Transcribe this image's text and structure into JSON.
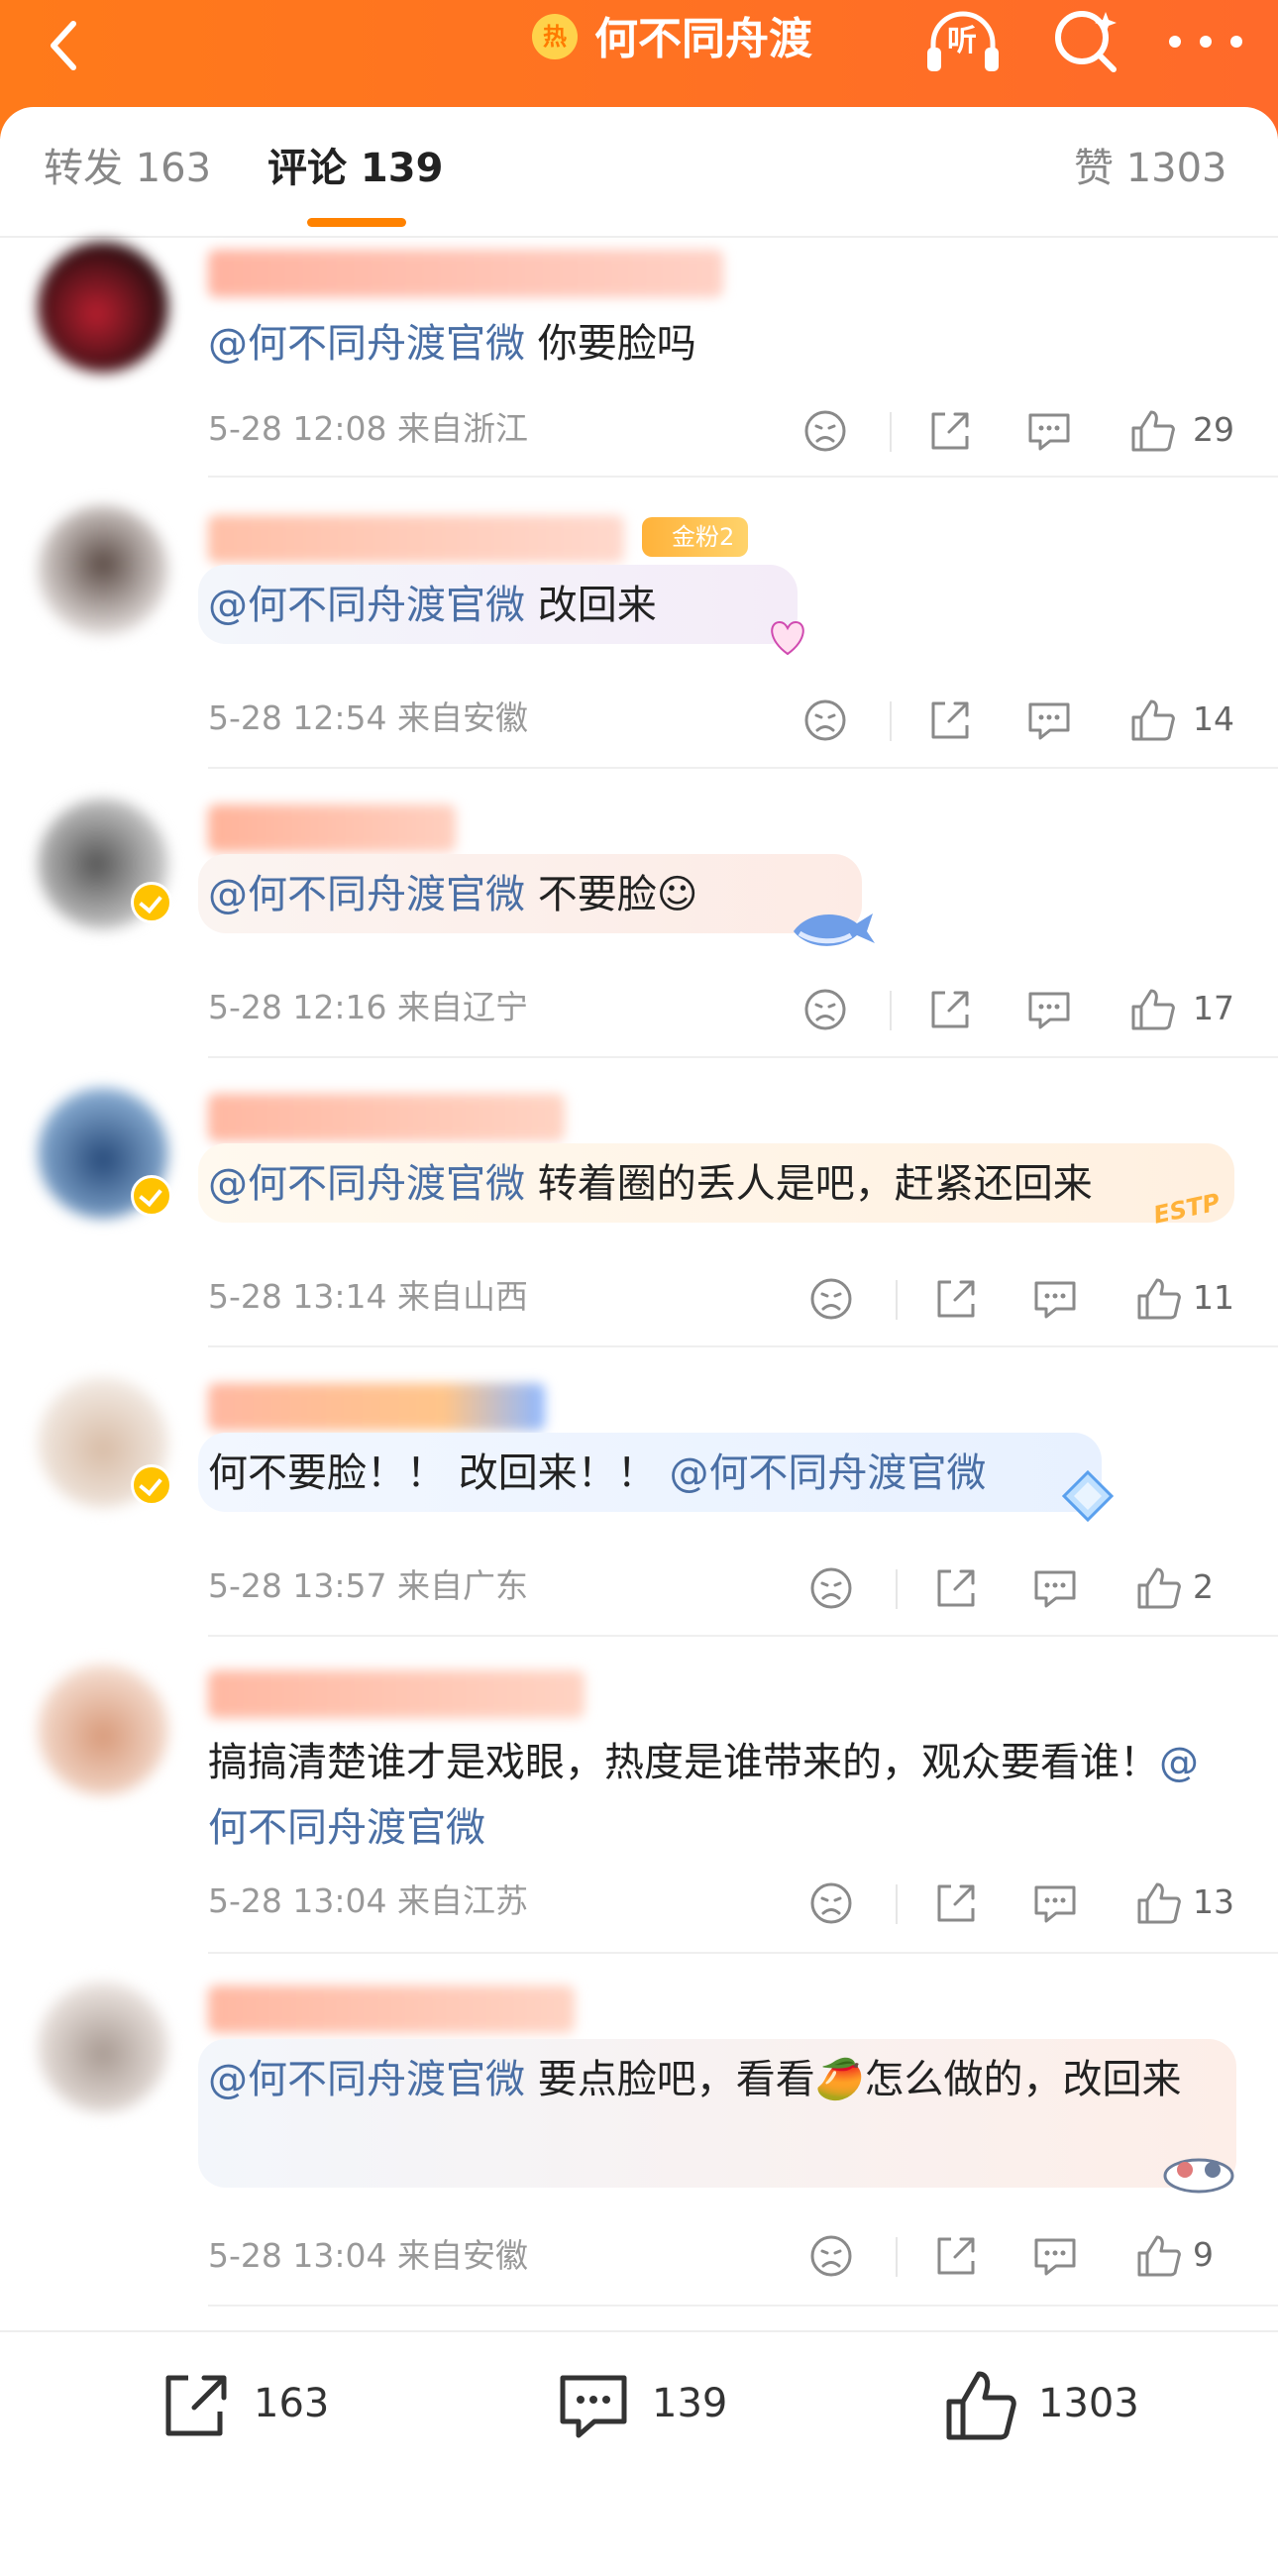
{
  "header": {
    "title": "何不同舟渡",
    "hot_label": "热",
    "listen_label": "听",
    "brand_color": "#ff7a1a"
  },
  "tabs": [
    {
      "label": "转发 163"
    },
    {
      "label": "评论 139"
    },
    {
      "label": "赞 1303"
    }
  ],
  "comments": [
    {
      "fan_badge": "",
      "at": "@何不同舟渡官微",
      "text": " 你要脸吗",
      "meta": "5-28 12:08  来自浙江",
      "likes": "29",
      "verified": false
    },
    {
      "fan_badge": "金粉2",
      "at": "@何不同舟渡官微",
      "text": " 改回来",
      "meta": "5-28 12:54  来自安徽",
      "likes": "14",
      "verified": false
    },
    {
      "fan_badge": "",
      "at": "@何不同舟渡官微",
      "text": " 不要脸☺",
      "meta": "5-28 12:16  来自辽宁",
      "likes": "17",
      "verified": true
    },
    {
      "fan_badge": "",
      "at": "@何不同舟渡官微",
      "text": " 转着圈的丢人是吧，赶紧还回来",
      "meta": "5-28 13:14  来自山西",
      "likes": "11",
      "verified": true,
      "sticker_label": "ESTP"
    },
    {
      "fan_badge": "",
      "pre_text": "何不要脸！！ 改回来！！ ",
      "at": "@何不同舟渡官微",
      "text": "",
      "meta": "5-28 13:57  来自广东",
      "likes": "2",
      "verified": true
    },
    {
      "fan_badge": "",
      "pre_text": "搞搞清楚谁才是戏眼，热度是谁带来的，观众要看谁！",
      "at": "@何不同舟渡官微",
      "text": "",
      "meta": "5-28 13:04  来自江苏",
      "likes": "13",
      "verified": false
    },
    {
      "fan_badge": "",
      "at": "@何不同舟渡官微",
      "text": " 要点脸吧，看看🥭怎么做的，改回来",
      "meta": "5-28 13:04  来自安徽",
      "likes": "9",
      "verified": false
    }
  ],
  "bottom_bar": {
    "repost_count": "163",
    "comment_count": "139",
    "like_count": "1303"
  }
}
